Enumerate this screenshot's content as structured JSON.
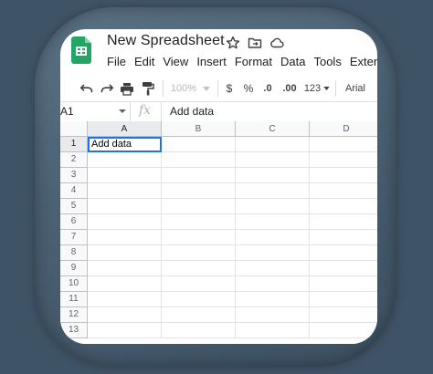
{
  "document": {
    "title": "New Spreadsheet",
    "title_icons": [
      "star-icon",
      "move-to-folder-icon",
      "cloud-status-icon"
    ]
  },
  "menu": [
    "File",
    "Edit",
    "View",
    "Insert",
    "Format",
    "Data",
    "Tools",
    "Extensi"
  ],
  "toolbar": {
    "zoom": "100%",
    "currency": "$",
    "percent": "%",
    "decrease_decimal": ".0",
    "increase_decimal": ".00",
    "number_format": "123",
    "font": "Arial"
  },
  "formula_bar": {
    "name_box": "A1",
    "fx": "fx",
    "content": "Add data"
  },
  "grid": {
    "columns": [
      "A",
      "B",
      "C",
      "D"
    ],
    "rows": [
      "1",
      "2",
      "3",
      "4",
      "5",
      "6",
      "7",
      "8",
      "9",
      "10",
      "11",
      "12",
      "13"
    ],
    "active_cell": "A1",
    "cells": {
      "A1": "Add data"
    }
  },
  "colors": {
    "brand": "#23a566",
    "selection": "#1a73e8",
    "background": "#3f5366"
  }
}
